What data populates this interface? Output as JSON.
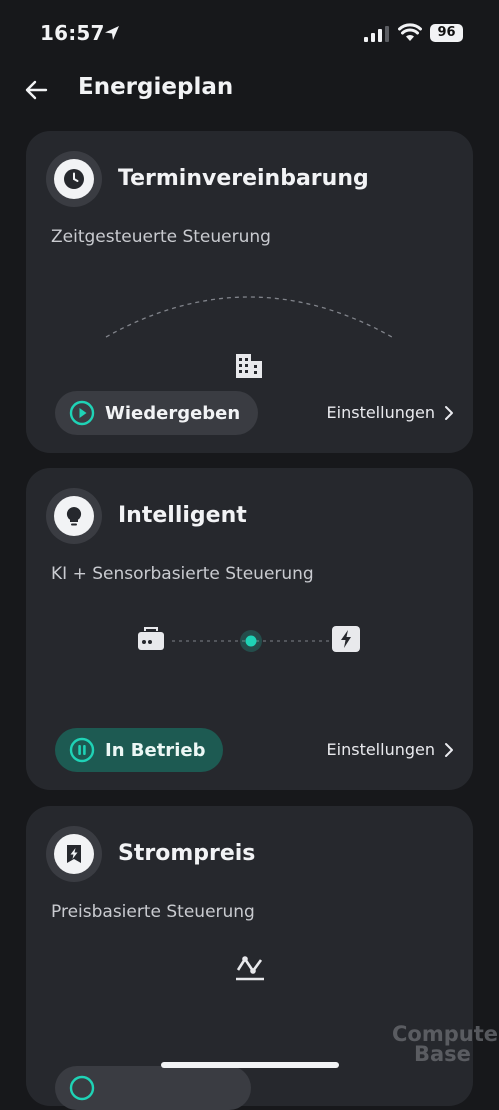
{
  "status": {
    "time": "16:57",
    "battery": "96"
  },
  "header": {
    "title": "Energieplan"
  },
  "cards": [
    {
      "title": "Terminvereinbarung",
      "subtitle": "Zeitgesteuerte Steuerung",
      "action": "Wiedergeben",
      "settings": "Einstellungen"
    },
    {
      "title": "Intelligent",
      "subtitle": "KI + Sensorbasierte Steuerung",
      "action": "In Betrieb",
      "settings": "Einstellungen"
    },
    {
      "title": "Strompreis",
      "subtitle": "Preisbasierte Steuerung"
    }
  ],
  "watermark": {
    "line1": "Computer",
    "line2": "Base"
  },
  "colors": {
    "background": "#17181b",
    "card": "#26282d",
    "accent": "#1fd3b6",
    "active_pill": "#1d5a52"
  },
  "icons": [
    "location-arrow-icon",
    "signal-icon",
    "wifi-icon",
    "back-arrow-icon",
    "clock-icon",
    "building-icon",
    "play-icon",
    "chevron-right-icon",
    "lightbulb-icon",
    "router-icon",
    "battery-bolt-icon",
    "pause-icon",
    "price-bolt-icon",
    "price-chart-icon"
  ]
}
